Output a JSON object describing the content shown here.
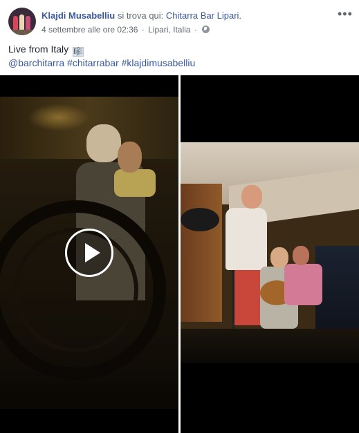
{
  "post": {
    "author": "Klajdi Musabelliu",
    "checkin_text": "si trova qui:",
    "place": "Chitarra Bar Lipari.",
    "timestamp": "4 settembre alle ore 02:36",
    "separator": "·",
    "location": "Lipari, Italia",
    "privacy_icon": "globe-icon",
    "more_label": "•••",
    "text_line1": "Live from Italy",
    "emoji_icon": "musical-score-emoji",
    "emoji_glyph": "🎼",
    "mention": "@barchitarra",
    "hashtag1": "#chitarrabar",
    "hashtag2": "#klajdimusabelliu"
  },
  "media": {
    "items": [
      {
        "type": "video",
        "play_icon": "play-icon"
      },
      {
        "type": "video"
      }
    ]
  },
  "colors": {
    "link": "#385898",
    "secondary_text": "#616770",
    "media_background": "#000000"
  }
}
